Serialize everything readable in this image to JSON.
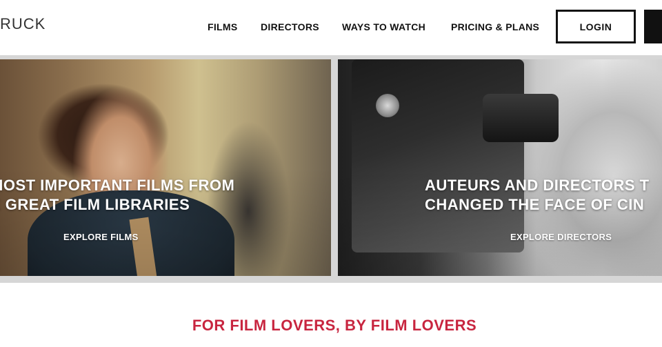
{
  "header": {
    "logo": "RUCK",
    "nav": [
      "FILMS",
      "DIRECTORS",
      "WAYS TO WATCH",
      "PRICING & PLANS"
    ],
    "login_label": "LOGIN"
  },
  "panels": {
    "films": {
      "headline_line1": "MOST IMPORTANT FILMS FROM",
      "headline_line2": "E GREAT FILM LIBRARIES",
      "cta": "EXPLORE FILMS"
    },
    "directors": {
      "headline_line1": "AUTEURS AND DIRECTORS T",
      "headline_line2": "CHANGED THE FACE OF CIN",
      "cta": "EXPLORE DIRECTORS"
    }
  },
  "tagline": "FOR FILM LOVERS, BY FILM LOVERS",
  "colors": {
    "accent": "#c8253f",
    "text": "#111111",
    "band": "#d6d6d6"
  }
}
